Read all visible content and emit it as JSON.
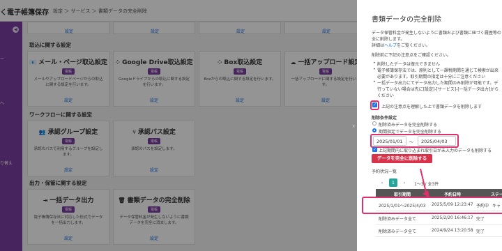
{
  "app": {
    "title": "く電子帳簿保存",
    "breadcrumb": "設定 ＞ サービス ＞ 書類データの完全削除",
    "sidebar_fragments": [
      "ー",
      "へ",
      "り替え"
    ]
  },
  "top_row_links": [
    "設定",
    "設定",
    "設定",
    "設定"
  ],
  "sections": {
    "import": "取込に関する設定",
    "workflow": "ワークフローに関する設定",
    "output": "出力・保管に関する設定"
  },
  "import_cards": [
    {
      "icon": "📧",
      "title": "メール・ページ取込設定",
      "badge": "電帳",
      "desc": "メールやアップロードページからの取込に関する設定を行います。",
      "link": "設定"
    },
    {
      "icon": "⁘",
      "title": "Google Drive取込設定",
      "badge": "電帳",
      "desc": "Googleドライブからの取込に関する設定を行います。",
      "link": "設定"
    },
    {
      "icon": "⁘",
      "title": "Box取込設定",
      "badge": "電帳",
      "desc": "Boxからの取込に関する設定を行います。",
      "link": "設定"
    },
    {
      "icon": "☁",
      "title": "一括アップロード設定",
      "badge": "電帳",
      "desc": "一括アップロードに関する設定を行います。",
      "link": "設定"
    }
  ],
  "workflow_cards": [
    {
      "icon": "👥",
      "title": "承認グループ設定",
      "badge": "電帳",
      "desc": "承認のパスで利用するグループを設定します。",
      "link": "設定"
    },
    {
      "icon": "⑂",
      "title": "承認パス設定",
      "badge": "電帳",
      "desc": "承認のパスを設定します。",
      "link": "設定"
    }
  ],
  "output_cards": [
    {
      "icon": "⇥",
      "title": "一括データ出力",
      "badge": "電帳",
      "desc": "電子帳簿保存法に対応した形式でデータを一括出力します。",
      "link": "設定"
    },
    {
      "icon": "🗑",
      "title": "書類データの完全削除",
      "badge": "電帳",
      "desc": "データ保管料金が発生しないように書類データを完全に消去します。",
      "link": "設定"
    }
  ],
  "drawer": {
    "edge_chevron": "›",
    "title": "書類データの完全削除",
    "intro_1": "データ保管料金が発生しないように書類および書類に紐づく履歴等の",
    "intro_2": "全に削除します。",
    "intro_3_prefix": "詳細は",
    "intro_3_link": "ヘルプ",
    "intro_3_suffix": "をご覧ください。",
    "notice_lead": "削除前に下記の注意点をご確認ください。",
    "bullets": [
      "削除したデータは復元できません",
      "電子帳簿保存法では、原則として一課税期間を通じて検索が出来",
      "必要があります。取引期間の指定は十分にご注意ください",
      "一括データ出力にてデータ出力した期間のみ削除が可能です。デ",
      "行っていない場合は先に[設定]-[サービス]-[一括データ出力]から",
      "ください"
    ],
    "confirm_checkbox_label": "上記の注意点を理解した上で書類データを削除します",
    "conditions_label": "削除条件設定",
    "radio_all": "削除済みデータを完全削除する",
    "radio_period": "期間指定でデータを完全削除する",
    "date_from": "2025/01/01",
    "date_sep": "〜",
    "date_to": "2025/04/03",
    "include_checkbox_label": "上記期間内に取り込まれ取引日が未入力のデータも削除する",
    "delete_button": "データを完全に削除する",
    "schedule_label": "予約状況一覧",
    "pager": {
      "prev": "‹",
      "page": "1",
      "next": "›",
      "count": "1〜3 / 全3件"
    },
    "table_headers": [
      "取引期間",
      "予約日時",
      "ステー"
    ],
    "rows": [
      {
        "period": "2025/1/01〜2025/4/03",
        "datetime": "2025/5/09 12:23:47",
        "status": "予約中",
        "action": "キャ"
      },
      {
        "period": "削除済みデータ全て",
        "datetime": "2025/2/20 16:46:17",
        "status": "完了",
        "action": ""
      },
      {
        "period": "削除済みデータ全て",
        "datetime": "2024/9/24 13:20:58",
        "status": "完了",
        "action": ""
      }
    ]
  },
  "colors": {
    "accent_purple": "#7a3fa0",
    "highlight_pink": "#e0306b",
    "danger_red": "#d8334a",
    "link_blue": "#1a73e8"
  }
}
